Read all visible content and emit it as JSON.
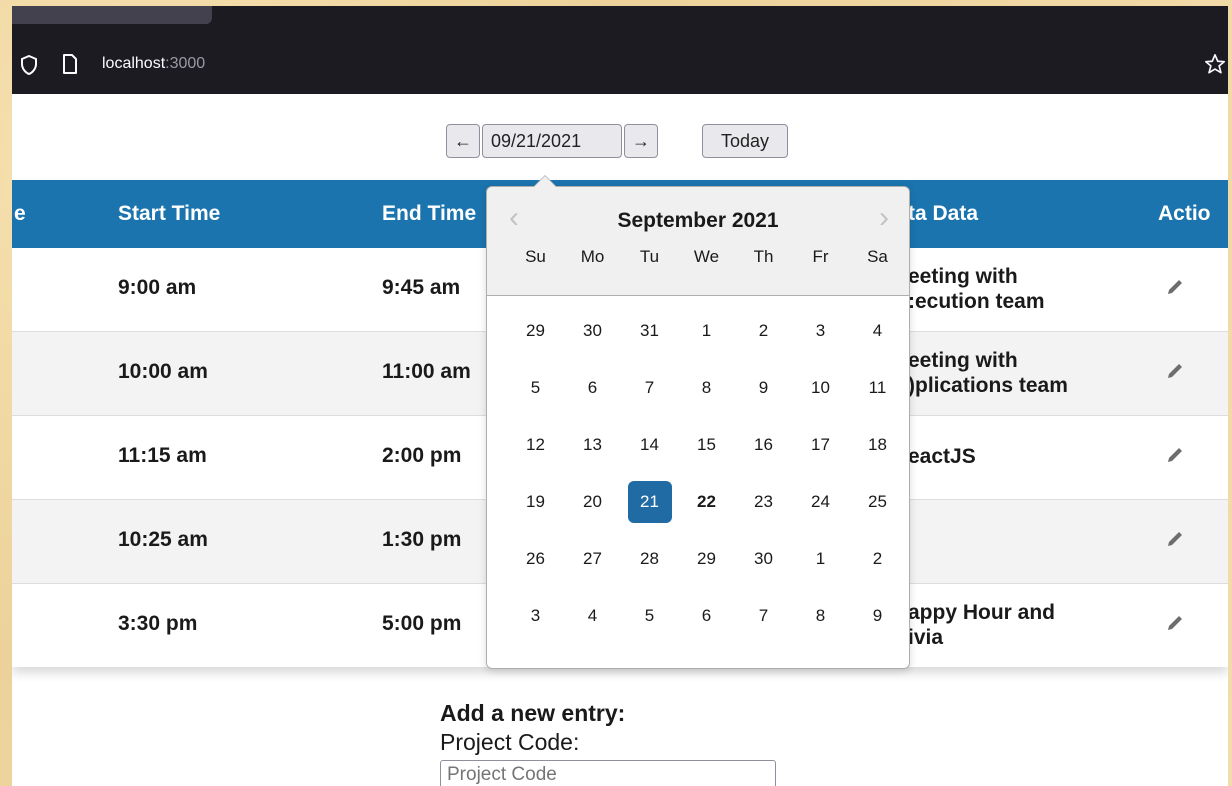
{
  "browser": {
    "url_host": "localhost",
    "url_port": ":3000"
  },
  "date_nav": {
    "prev_label": "←",
    "date_value": "09/21/2021",
    "next_label": "→",
    "today_label": "Today"
  },
  "table": {
    "headers": [
      "e",
      "Start Time",
      "End Time",
      "ta Data",
      "Actio"
    ],
    "rows": [
      {
        "start": "9:00 am",
        "end": "9:45 am",
        "meta": "eeting with\n:ecution team"
      },
      {
        "start": "10:00 am",
        "end": "11:00 am",
        "meta": "eeting with\n)plications team"
      },
      {
        "start": "11:15 am",
        "end": "2:00 pm",
        "meta": "eactJS"
      },
      {
        "start": "10:25 am",
        "end": "1:30 pm",
        "meta": ""
      },
      {
        "start": "3:30 pm",
        "end": "5:00 pm",
        "meta": "appy Hour and\nivia"
      }
    ]
  },
  "datepicker": {
    "title": "September 2021",
    "prev_label": "‹",
    "next_label": "›",
    "weekdays": [
      "Su",
      "Mo",
      "Tu",
      "We",
      "Th",
      "Fr",
      "Sa"
    ],
    "weeks": [
      [
        "29",
        "30",
        "31",
        "1",
        "2",
        "3",
        "4"
      ],
      [
        "5",
        "6",
        "7",
        "8",
        "9",
        "10",
        "11"
      ],
      [
        "12",
        "13",
        "14",
        "15",
        "16",
        "17",
        "18"
      ],
      [
        "19",
        "20",
        "21",
        "22",
        "23",
        "24",
        "25"
      ],
      [
        "26",
        "27",
        "28",
        "29",
        "30",
        "1",
        "2"
      ],
      [
        "3",
        "4",
        "5",
        "6",
        "7",
        "8",
        "9"
      ]
    ],
    "selected_day": "21",
    "today_day": "22",
    "selected_color": "#216ba5"
  },
  "form": {
    "heading": "Add a new entry:",
    "project_code_label": "Project Code:",
    "project_code_placeholder": "Project Code"
  },
  "colors": {
    "header_bg": "#1b74ae",
    "browser_bg": "#1c1b22"
  }
}
